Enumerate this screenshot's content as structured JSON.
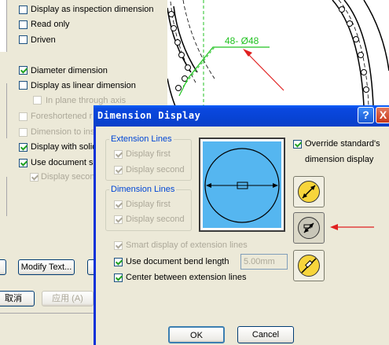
{
  "background_dialog": {
    "options": [
      {
        "label": "Display as inspection dimension",
        "checked": false,
        "disabled": false
      },
      {
        "label": "Read only",
        "checked": false,
        "disabled": false
      },
      {
        "label": "Driven",
        "checked": false,
        "disabled": false
      },
      {
        "label": "Diameter dimension",
        "checked": true,
        "disabled": false
      },
      {
        "label": "Display as linear dimension",
        "checked": false,
        "disabled": false
      },
      {
        "label": "In plane through axis",
        "checked": false,
        "disabled": true
      },
      {
        "label": "Foreshortened r",
        "checked": false,
        "disabled": true
      },
      {
        "label": "Dimension to insi",
        "checked": false,
        "disabled": true
      },
      {
        "label": "Display with solid",
        "checked": true,
        "disabled": false
      },
      {
        "label": "Use document se",
        "checked": true,
        "disabled": false
      },
      {
        "label": "Display second",
        "checked": true,
        "disabled": true
      }
    ],
    "modify_text_label": "Modify Text...",
    "cancel_label": "取消",
    "apply_label": "应用 (A)"
  },
  "drawing": {
    "dimension_label": "48- Ø48"
  },
  "dialog": {
    "title": "Dimension Display",
    "help_label": "?",
    "close_label": "X",
    "extension_lines": {
      "title": "Extension Lines",
      "display_first": {
        "label": "Display first",
        "checked": true,
        "disabled": true
      },
      "display_second": {
        "label": "Display second",
        "checked": true,
        "disabled": true
      }
    },
    "dimension_lines": {
      "title": "Dimension Lines",
      "display_first": {
        "label": "Display first",
        "checked": true,
        "disabled": true
      },
      "display_second": {
        "label": "Display second",
        "checked": true,
        "disabled": true
      }
    },
    "override_label": "Override standard's dimension display",
    "override_line1": "Override standard's",
    "override_line2": "dimension display",
    "override_checked": true,
    "smart_display_label": "Smart display of extension lines",
    "use_bend_length_label": "Use document bend length",
    "bend_length_value": "5.00mm",
    "center_between_label": "Center between extension lines",
    "ok_label": "OK",
    "cancel_label": "Cancel",
    "style_buttons": [
      {
        "name": "diameter-inside-style",
        "selected": false
      },
      {
        "name": "diameter-radial-style",
        "selected": true
      },
      {
        "name": "diameter-linear-style",
        "selected": false
      }
    ]
  },
  "colors": {
    "dialog_face": "#ece9d8",
    "title_blue": "#0a48e0",
    "group_label_blue": "#0046d5",
    "preview_blue": "#55b6f0",
    "dimension_green": "#21c221",
    "arrow_red": "#e02020",
    "icon_yellow": "#f7d53b"
  }
}
